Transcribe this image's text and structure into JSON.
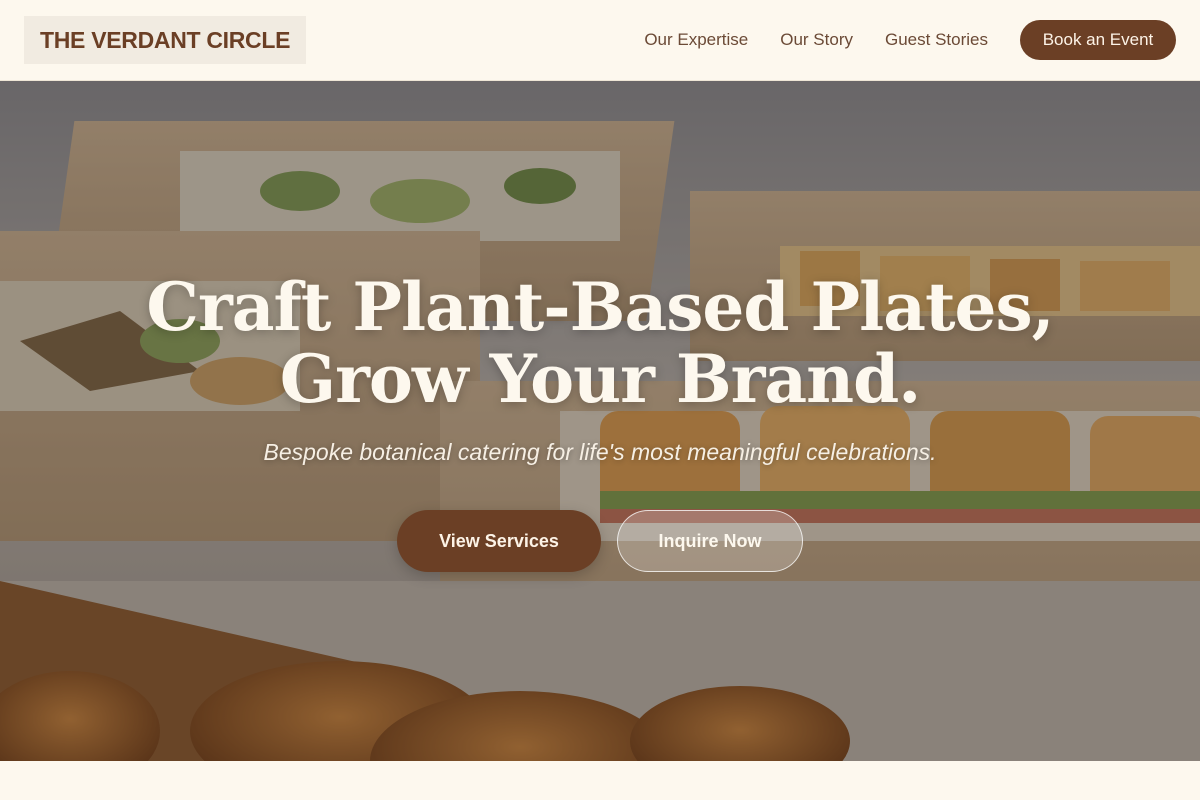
{
  "header": {
    "logo": "THE VERDANT CIRCLE",
    "nav": [
      "Our Expertise",
      "Our Story",
      "Guest Stories"
    ],
    "cta": "Book an Event"
  },
  "hero": {
    "title_line1": "Craft Plant-Based Plates,",
    "title_line2": "Grow Your Brand.",
    "subtitle": "Bespoke botanical catering for life's most meaningful celebrations.",
    "primary_button": "View Services",
    "secondary_button": "Inquire Now",
    "image": "catering-boxes-photo"
  },
  "colors": {
    "accent": "#6b3f25",
    "background": "#fdf8ee",
    "logo_bg": "#f1ebe1"
  }
}
